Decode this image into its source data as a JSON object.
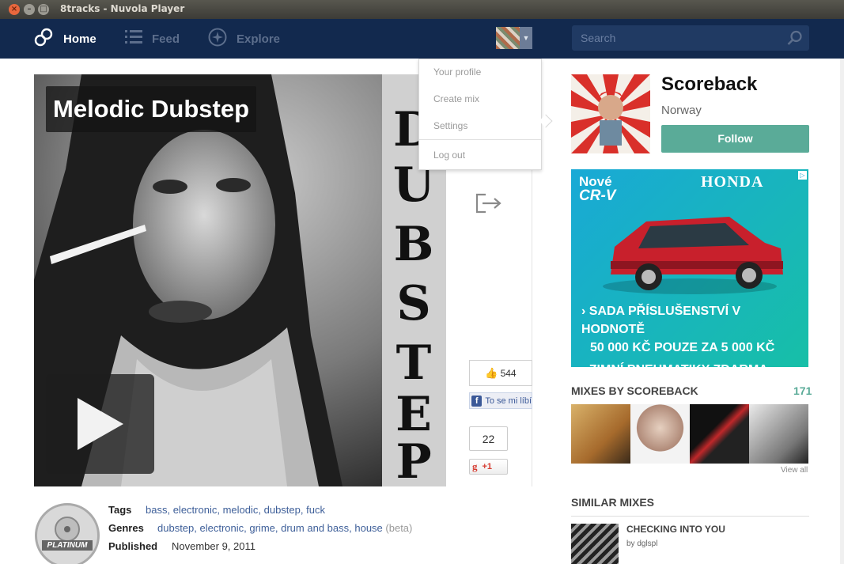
{
  "window": {
    "title": "8tracks - Nuvola Player"
  },
  "nav": {
    "home": "Home",
    "feed": "Feed",
    "explore": "Explore",
    "search_placeholder": "Search"
  },
  "dropdown": {
    "items": [
      "Your profile",
      "Create mix",
      "Settings",
      "Log out"
    ]
  },
  "mix": {
    "title": "Melodic Dubstep",
    "cover_text": "DUBSTEP",
    "like_count": "544",
    "fb_like": "To se mi líbí",
    "gplus_count": "22",
    "gplus_label": "+1",
    "badge": "PLATINUM",
    "tags_label": "Tags",
    "tags": [
      "bass",
      "electronic",
      "melodic",
      "dubstep",
      "fuck"
    ],
    "genres_label": "Genres",
    "genres": [
      "dubstep",
      "electronic",
      "grime",
      "drum and bass",
      "house"
    ],
    "genres_beta": "(beta)",
    "published_label": "Published",
    "published": "November 9, 2011"
  },
  "user": {
    "name": "Scoreback",
    "country": "Norway",
    "follow": "Follow"
  },
  "ad": {
    "nove": "Nové",
    "model": "CR-V",
    "brand": "HONDA",
    "line1": "› SADA PŘÍSLUŠENSTVÍ V HODNOTĚ",
    "line2": "50 000 KČ POUZE ZA 5 000 KČ",
    "line3": "› ZIMNÍ PNEUMATIKY ZDARMA"
  },
  "mixes_by": {
    "title": "MIXES BY SCOREBACK",
    "count": "171",
    "view_all": "View all"
  },
  "similar": {
    "title": "SIMILAR MIXES",
    "items": [
      {
        "title": "CHECKING INTO YOU",
        "by": "by dglspl"
      }
    ]
  },
  "colors": {
    "nav_bg": "#12294e",
    "follow": "#5aab98",
    "link": "#3e5f99",
    "count": "#5aab98"
  }
}
